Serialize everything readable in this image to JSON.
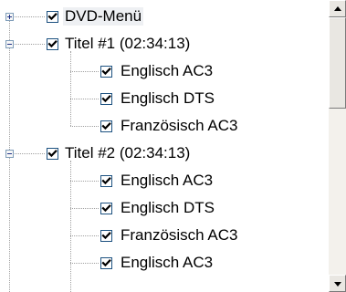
{
  "tree": {
    "nodes": [
      {
        "label": "DVD-Menü",
        "depth": 0,
        "expander": "plus",
        "checked": true
      },
      {
        "label": "Titel #1 (02:34:13)",
        "depth": 0,
        "expander": "minus",
        "checked": true
      },
      {
        "label": "Englisch AC3",
        "depth": 1,
        "expander": null,
        "checked": true
      },
      {
        "label": "Englisch DTS",
        "depth": 1,
        "expander": null,
        "checked": true
      },
      {
        "label": "Französisch AC3",
        "depth": 1,
        "expander": null,
        "checked": true
      },
      {
        "label": "Titel #2 (02:34:13)",
        "depth": 0,
        "expander": "minus",
        "checked": true
      },
      {
        "label": "Englisch AC3",
        "depth": 1,
        "expander": null,
        "checked": true
      },
      {
        "label": "Englisch DTS",
        "depth": 1,
        "expander": null,
        "checked": true
      },
      {
        "label": "Französisch AC3",
        "depth": 1,
        "expander": null,
        "checked": true
      },
      {
        "label": "Englisch AC3",
        "depth": 1,
        "expander": null,
        "checked": true
      }
    ]
  },
  "icons": {
    "expand": "plus-box-icon",
    "collapse": "minus-box-icon",
    "check": "checkmark-icon",
    "scroll_up": "arrow-up-icon",
    "scroll_down": "arrow-down-icon"
  }
}
